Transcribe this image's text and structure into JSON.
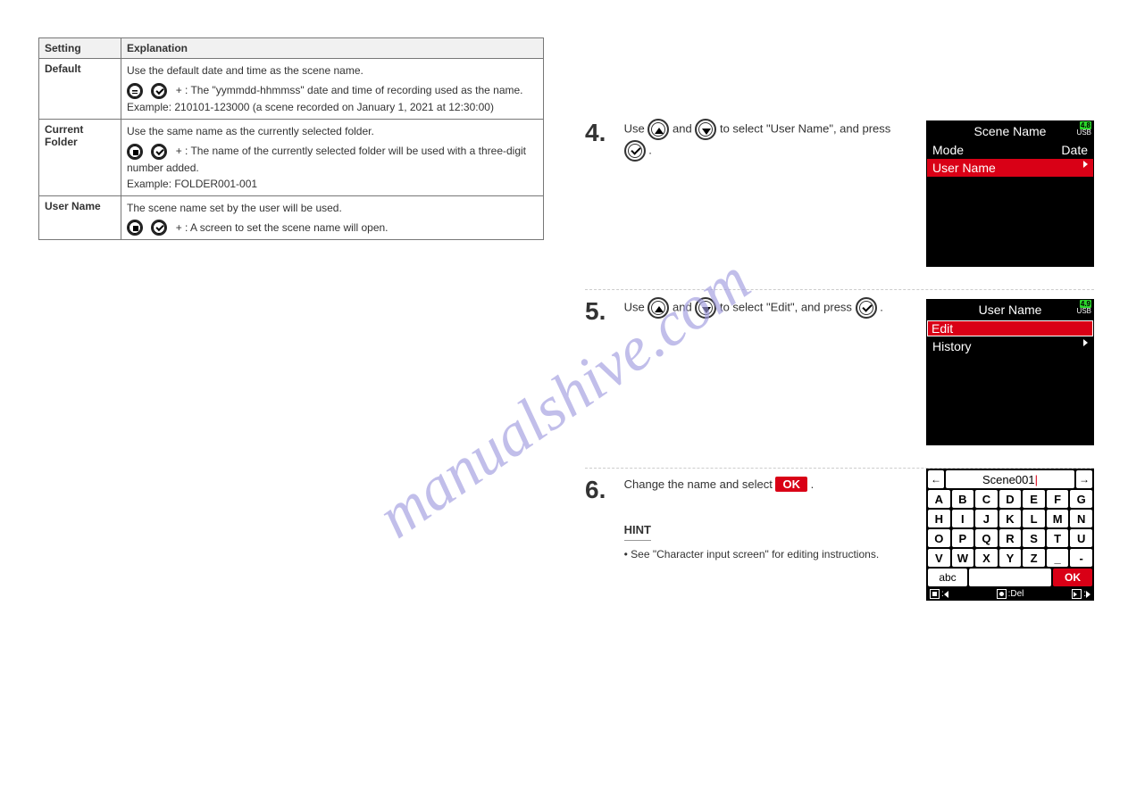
{
  "watermark": "manualshive.com",
  "table": {
    "header": {
      "c1": "Setting",
      "c2": "Explanation"
    },
    "rows": [
      {
        "name": "Default",
        "line1": "Use the default date and time as the scene name.",
        "hint": "+   : The \"yymmdd-hhmmss\" date and time of recording used as the name.",
        "line2": "Example: 210101-123000 (a scene recorded on January 1, 2021 at 12:30:00)"
      },
      {
        "name": "Current Folder",
        "line1": "Use the same name as the currently selected folder.",
        "hint": "+   : The name of the currently selected folder will be used with a three-digit number added.",
        "line2": "Example: FOLDER001-001"
      },
      {
        "name": "User Name",
        "line1": "The scene name set by the user will be used.",
        "hint": "+   : A screen to set the scene name will open."
      }
    ]
  },
  "steps": [
    {
      "num": "4.",
      "text_a": "Use",
      "text_b": "and",
      "text_c": "to select \"User Name\", and press",
      "text_d": "."
    },
    {
      "num": "5.",
      "text_a": "Use",
      "text_b": "and",
      "text_c": "to select \"Edit\", and press",
      "text_d": "."
    },
    {
      "num": "6.",
      "text_a": "Change the name and select",
      "text_ok": "OK",
      "text_b": ".",
      "hint_label": "HINT",
      "hint_bullet": "• See \"Character input screen\" for editing instructions."
    }
  ],
  "dev1": {
    "title": "Scene Name",
    "badge_level": "4.8",
    "badge_usb": "USB",
    "row_mode_l": "Mode",
    "row_mode_r": "Date",
    "row_sel": "User Name"
  },
  "dev2": {
    "title": "User Name",
    "badge_level": "4.9",
    "badge_usb": "USB",
    "row_sel": "Edit",
    "row2": "History"
  },
  "kbd": {
    "value": "Scene001",
    "keys": [
      "A",
      "B",
      "C",
      "D",
      "E",
      "F",
      "G",
      "H",
      "I",
      "J",
      "K",
      "L",
      "M",
      "N",
      "O",
      "P",
      "Q",
      "R",
      "S",
      "T",
      "U",
      "V",
      "W",
      "X",
      "Y",
      "Z",
      "_",
      "-"
    ],
    "abc": "abc",
    "ok": "OK",
    "hint_del": ":Del"
  }
}
